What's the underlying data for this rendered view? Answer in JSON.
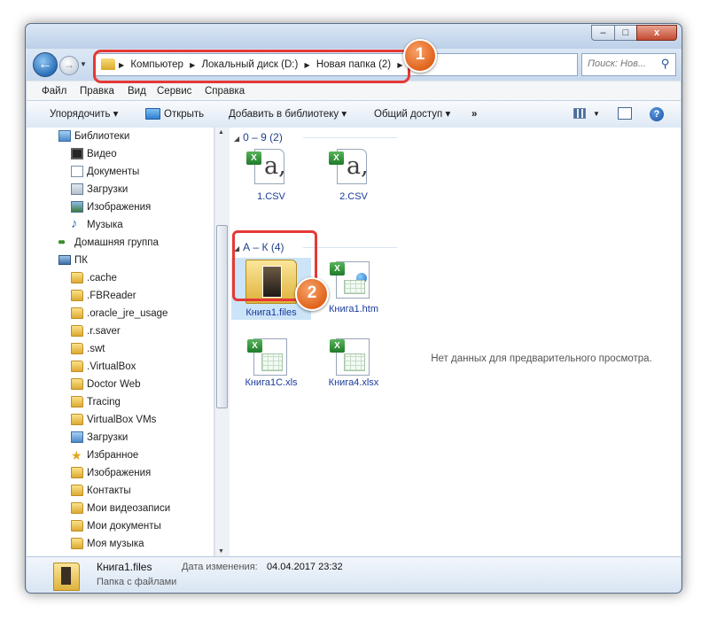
{
  "window": {
    "controls": {
      "minimize": "–",
      "maximize": "□",
      "close": "x"
    }
  },
  "address": {
    "back": "←",
    "forward": "→",
    "history": "▼",
    "breadcrumb": [
      "Компьютер",
      "Локальный диск (D:)",
      "Новая папка (2)"
    ],
    "separator": "▶",
    "dropdown": "▼",
    "refresh": "⇆",
    "search_placeholder": "Поиск: Нов..."
  },
  "menu": [
    "Файл",
    "Правка",
    "Вид",
    "Сервис",
    "Справка"
  ],
  "commands": {
    "organize": "Упорядочить ▾",
    "open": "Открыть",
    "add_to_library": "Добавить в библиотеку ▾",
    "share": "Общий доступ ▾",
    "more": "»",
    "view_dropdown": "▼",
    "help": "?"
  },
  "nav_tree": [
    {
      "label": "Библиотеки",
      "icon": "library-icon",
      "indent": 0
    },
    {
      "label": "Видео",
      "icon": "video-icon",
      "indent": 1
    },
    {
      "label": "Документы",
      "icon": "document-icon",
      "indent": 1
    },
    {
      "label": "Загрузки",
      "icon": "downloads-icon",
      "indent": 1
    },
    {
      "label": "Изображения",
      "icon": "image-icon",
      "indent": 1
    },
    {
      "label": "Музыка",
      "icon": "music-icon",
      "indent": 1
    },
    {
      "label": "Домашняя группа",
      "icon": "homegroup-icon",
      "indent": 0
    },
    {
      "label": "ПК",
      "icon": "computer-icon",
      "indent": 0
    },
    {
      "label": ".cache",
      "icon": "folder-icon",
      "indent": 1
    },
    {
      "label": ".FBReader",
      "icon": "folder-icon",
      "indent": 1
    },
    {
      "label": ".oracle_jre_usage",
      "icon": "folder-icon",
      "indent": 1
    },
    {
      "label": ".r.saver",
      "icon": "folder-icon",
      "indent": 1
    },
    {
      "label": ".swt",
      "icon": "folder-icon",
      "indent": 1
    },
    {
      "label": ".VirtualBox",
      "icon": "folder-icon",
      "indent": 1
    },
    {
      "label": "Doctor Web",
      "icon": "folder-icon",
      "indent": 1
    },
    {
      "label": "Tracing",
      "icon": "folder-icon",
      "indent": 1
    },
    {
      "label": "VirtualBox VMs",
      "icon": "folder-icon",
      "indent": 1
    },
    {
      "label": "Загрузки",
      "icon": "downloads-folder-icon",
      "indent": 1
    },
    {
      "label": "Избранное",
      "icon": "favorites-icon",
      "indent": 1
    },
    {
      "label": "Изображения",
      "icon": "images-folder-icon",
      "indent": 1
    },
    {
      "label": "Контакты",
      "icon": "contacts-icon",
      "indent": 1
    },
    {
      "label": "Мои видеозаписи",
      "icon": "videos-folder-icon",
      "indent": 1
    },
    {
      "label": "Мои документы",
      "icon": "documents-folder-icon",
      "indent": 1
    },
    {
      "label": "Моя музыка",
      "icon": "music-folder-icon",
      "indent": 1
    }
  ],
  "scrollbar": {
    "up": "▲",
    "down": "▼",
    "grip": "≡"
  },
  "groups": [
    {
      "header": "0 – 9 (2)",
      "files": [
        {
          "name": "1.CSV",
          "icon": "csv-icon"
        },
        {
          "name": "2.CSV",
          "icon": "csv-icon"
        }
      ]
    },
    {
      "header": "А – К (4)",
      "files": [
        {
          "name": "Книга1.files",
          "icon": "folder-icon",
          "selected": true
        },
        {
          "name": "Книга1.htm",
          "icon": "excel-html-icon"
        },
        {
          "name": "Книга1С.xls",
          "icon": "excel-icon"
        },
        {
          "name": "Книга4.xlsx",
          "icon": "excel-icon"
        }
      ]
    }
  ],
  "group_toggle": "◢",
  "preview": {
    "empty_text": "Нет данных для предварительного просмотра."
  },
  "details": {
    "name": "Книга1.files",
    "modified_label": "Дата изменения:",
    "modified_value": "04.04.2017 23:32",
    "type": "Папка с файлами"
  },
  "callouts": [
    "1",
    "2"
  ],
  "colors": {
    "highlight": "#e53935",
    "badge": "#e0631b",
    "link": "#1a3a9c"
  }
}
